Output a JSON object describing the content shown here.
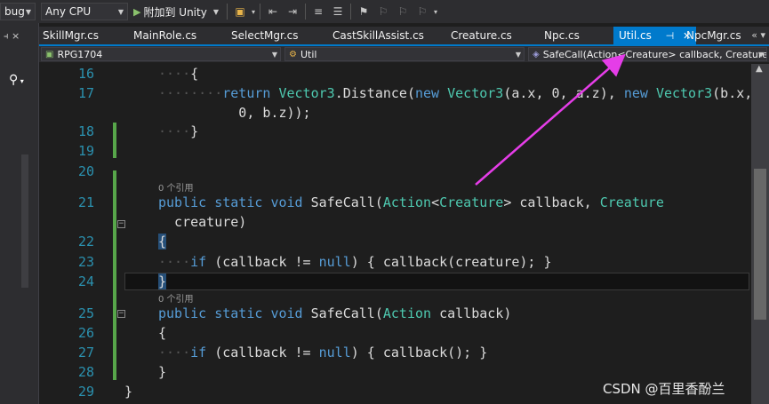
{
  "toolbar": {
    "config_fragment": "bug",
    "platform": "Any CPU",
    "attach_label": "附加到 Unity",
    "attach_icon": "play-icon"
  },
  "tabs": [
    {
      "label": "SkillMgr.cs"
    },
    {
      "label": "MainRole.cs"
    },
    {
      "label": "SelectMgr.cs"
    },
    {
      "label": "CastSkillAssist.cs"
    },
    {
      "label": "Creature.cs"
    },
    {
      "label": "Npc.cs"
    },
    {
      "label": "Util.cs",
      "active": true
    },
    {
      "label": "NpcMgr.cs"
    }
  ],
  "navbar": {
    "project": "RPG1704",
    "type": "Util",
    "member": "SafeCall(Action<Creature> callback, Creature"
  },
  "editor": {
    "lines": [
      {
        "n": "16"
      },
      {
        "n": "17"
      },
      {
        "n": "18"
      },
      {
        "n": "19"
      },
      {
        "n": "20"
      },
      {
        "n": "21"
      },
      {
        "n": "22"
      },
      {
        "n": "23"
      },
      {
        "n": "24"
      },
      {
        "n": "25"
      },
      {
        "n": "26"
      },
      {
        "n": "27"
      },
      {
        "n": "28"
      },
      {
        "n": "29"
      }
    ],
    "codelens_1": "0 个引用",
    "codelens_2": "0 个引用"
  },
  "watermark": "CSDN @百里香酚兰",
  "colors": {
    "accent": "#007acc",
    "keyword": "#569cd6",
    "type": "#4ec9b0",
    "line_number": "#2b91af",
    "arrow": "#e53de8",
    "change_bar": "#57a64a"
  }
}
